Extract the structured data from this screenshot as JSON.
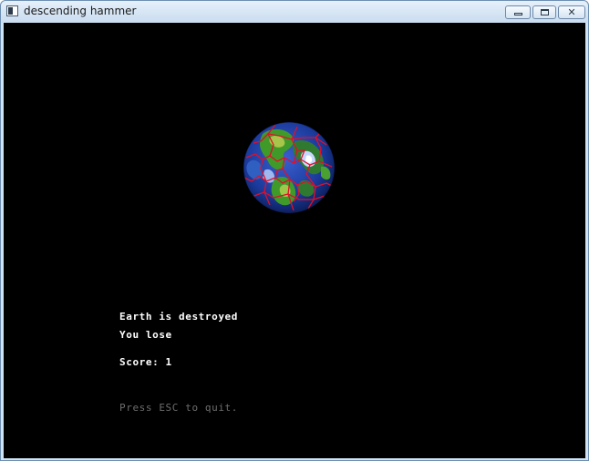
{
  "window": {
    "title": "descending hammer",
    "buttons": {
      "minimize": "minimize-icon",
      "maximize": "maximize-icon",
      "close": "close-icon"
    }
  },
  "game": {
    "background_color": "#000000",
    "planet": "cracked-earth-icon",
    "crack_color": "#e0102a",
    "ocean_color": "#1b3a9c",
    "land_color": "#3f9a2a",
    "lines": {
      "status": "Earth is destroyed",
      "result": "You lose",
      "score": "Score: 1",
      "hint": "Press ESC to quit."
    }
  }
}
